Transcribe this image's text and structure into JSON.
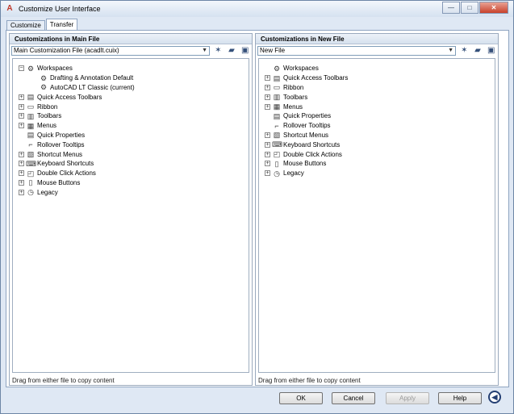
{
  "window": {
    "title": "Customize User Interface",
    "controls": {
      "minimize": "—",
      "maximize": "□",
      "close": "✕"
    }
  },
  "tabs": [
    {
      "label": "Customize",
      "active": false
    },
    {
      "label": "Transfer",
      "active": true
    }
  ],
  "left_panel": {
    "header": "Customizations in Main File",
    "file_select": "Main Customization File (acadlt.cuix)",
    "footer": "Drag from either file to copy content",
    "tree": [
      {
        "label": "Workspaces",
        "icon": "workspaces-icon",
        "glyph": "⚙",
        "level": 0,
        "expander": "−"
      },
      {
        "label": "Drafting & Annotation Default",
        "icon": "workspace-icon",
        "glyph": "⚙",
        "level": 1,
        "expander": ""
      },
      {
        "label": "AutoCAD LT Classic (current)",
        "icon": "workspace-icon",
        "glyph": "⚙",
        "level": 1,
        "expander": ""
      },
      {
        "label": "Quick Access Toolbars",
        "icon": "quick-access-toolbars-icon",
        "glyph": "▤",
        "level": 0,
        "expander": "+"
      },
      {
        "label": "Ribbon",
        "icon": "ribbon-icon",
        "glyph": "▭",
        "level": 0,
        "expander": "+"
      },
      {
        "label": "Toolbars",
        "icon": "toolbars-icon",
        "glyph": "▥",
        "level": 0,
        "expander": "+"
      },
      {
        "label": "Menus",
        "icon": "menus-icon",
        "glyph": "▦",
        "level": 0,
        "expander": "+"
      },
      {
        "label": "Quick Properties",
        "icon": "quick-properties-icon",
        "glyph": "▤",
        "level": 0,
        "expander": ""
      },
      {
        "label": "Rollover Tooltips",
        "icon": "rollover-tooltips-icon",
        "glyph": "⌐",
        "level": 0,
        "expander": ""
      },
      {
        "label": "Shortcut Menus",
        "icon": "shortcut-menus-icon",
        "glyph": "▧",
        "level": 0,
        "expander": "+"
      },
      {
        "label": "Keyboard Shortcuts",
        "icon": "keyboard-shortcuts-icon",
        "glyph": "⌨",
        "level": 0,
        "expander": "+"
      },
      {
        "label": "Double Click Actions",
        "icon": "double-click-actions-icon",
        "glyph": "◰",
        "level": 0,
        "expander": "+"
      },
      {
        "label": "Mouse Buttons",
        "icon": "mouse-buttons-icon",
        "glyph": "▯",
        "level": 0,
        "expander": "+"
      },
      {
        "label": "Legacy",
        "icon": "legacy-icon",
        "glyph": "◷",
        "level": 0,
        "expander": "+"
      }
    ]
  },
  "right_panel": {
    "header": "Customizations in New File",
    "file_select": "New File",
    "footer": "Drag from either file to copy content",
    "tree": [
      {
        "label": "Workspaces",
        "icon": "workspaces-icon",
        "glyph": "⚙",
        "level": 0,
        "expander": ""
      },
      {
        "label": "Quick Access Toolbars",
        "icon": "quick-access-toolbars-icon",
        "glyph": "▤",
        "level": 0,
        "expander": "+"
      },
      {
        "label": "Ribbon",
        "icon": "ribbon-icon",
        "glyph": "▭",
        "level": 0,
        "expander": "+"
      },
      {
        "label": "Toolbars",
        "icon": "toolbars-icon",
        "glyph": "▥",
        "level": 0,
        "expander": "+"
      },
      {
        "label": "Menus",
        "icon": "menus-icon",
        "glyph": "▦",
        "level": 0,
        "expander": "+"
      },
      {
        "label": "Quick Properties",
        "icon": "quick-properties-icon",
        "glyph": "▤",
        "level": 0,
        "expander": ""
      },
      {
        "label": "Rollover Tooltips",
        "icon": "rollover-tooltips-icon",
        "glyph": "⌐",
        "level": 0,
        "expander": ""
      },
      {
        "label": "Shortcut Menus",
        "icon": "shortcut-menus-icon",
        "glyph": "▧",
        "level": 0,
        "expander": "+"
      },
      {
        "label": "Keyboard Shortcuts",
        "icon": "keyboard-shortcuts-icon",
        "glyph": "⌨",
        "level": 0,
        "expander": "+"
      },
      {
        "label": "Double Click Actions",
        "icon": "double-click-actions-icon",
        "glyph": "◰",
        "level": 0,
        "expander": "+"
      },
      {
        "label": "Mouse Buttons",
        "icon": "mouse-buttons-icon",
        "glyph": "▯",
        "level": 0,
        "expander": "+"
      },
      {
        "label": "Legacy",
        "icon": "legacy-icon",
        "glyph": "◷",
        "level": 0,
        "expander": "+"
      }
    ]
  },
  "toolbar_icons": {
    "new": "✶",
    "open": "▰",
    "save": "▣"
  },
  "buttons": {
    "ok": "OK",
    "cancel": "Cancel",
    "apply": "Apply",
    "help": "Help",
    "collapse": "◀"
  }
}
